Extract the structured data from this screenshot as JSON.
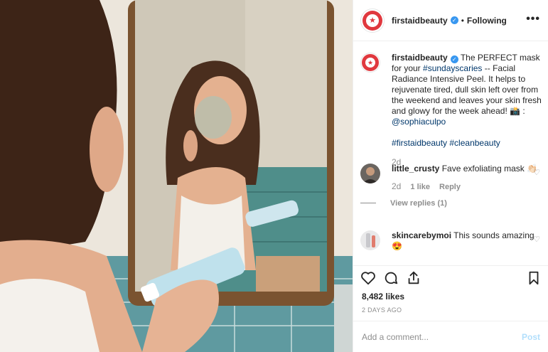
{
  "header": {
    "username": "firstaidbeauty",
    "verified_glyph": "✓",
    "separator": "•",
    "follow_status": "Following",
    "more_icon": "more-options-icon",
    "more_glyph": "•••"
  },
  "caption": {
    "username": "firstaidbeauty",
    "text_1": "The PERFECT mask for your",
    "hashtag_1": "#sundayscaries",
    "text_2": "-- Facial Radiance Intensive Peel. It helps to rejuvenate tired, dull skin left over from the weekend and leaves your skin fresh and glowy for the week ahead! 📸 :",
    "mention": "@sophiaculpo",
    "hashtags": "#firstaidbeauty #cleanbeauty",
    "time": "2d"
  },
  "comments": [
    {
      "username": "little_crusty",
      "text": "Fave exfoliating mask 👏🏻",
      "time": "2d",
      "likes": "1 like",
      "reply": "Reply",
      "view_replies": "View replies (1)"
    },
    {
      "username": "skincarebymoi",
      "text": "This sounds amazing 😍"
    }
  ],
  "actions": {
    "likes": "8,482 likes",
    "posted": "2 DAYS AGO"
  },
  "composer": {
    "placeholder": "Add a comment...",
    "post_label": "Post"
  },
  "colors": {
    "brand_red": "#e0383e",
    "verified_blue": "#3897f0",
    "link": "#00376b",
    "post_disabled": "#b2dffc"
  }
}
